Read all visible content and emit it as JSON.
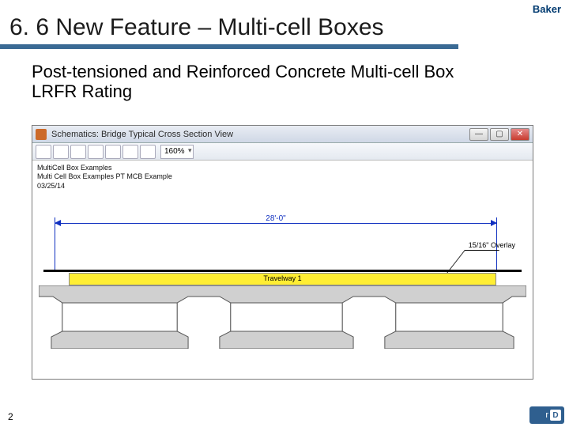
{
  "logo_text": "Baker",
  "slide": {
    "title": "6. 6 New Feature – Multi-cell Boxes",
    "subtitle": "Post-tensioned and Reinforced Concrete Multi-cell Box LRFR Rating",
    "page_number": "2"
  },
  "app": {
    "window_title": "Schematics: Bridge Typical Cross Section View",
    "toolbar": {
      "zoom": "160%"
    },
    "meta": {
      "line1": "MultiCell Box Examples",
      "line2": "Multi Cell Box Examples   PT MCB Example",
      "line3": "03/25/14"
    },
    "drawing": {
      "span_dimension": "28'-0\"",
      "overlay_label": "15/16\" Overlay",
      "travelway_label": "Travelway 1"
    }
  },
  "footer_logo": {
    "r": "r",
    "d": "D"
  }
}
